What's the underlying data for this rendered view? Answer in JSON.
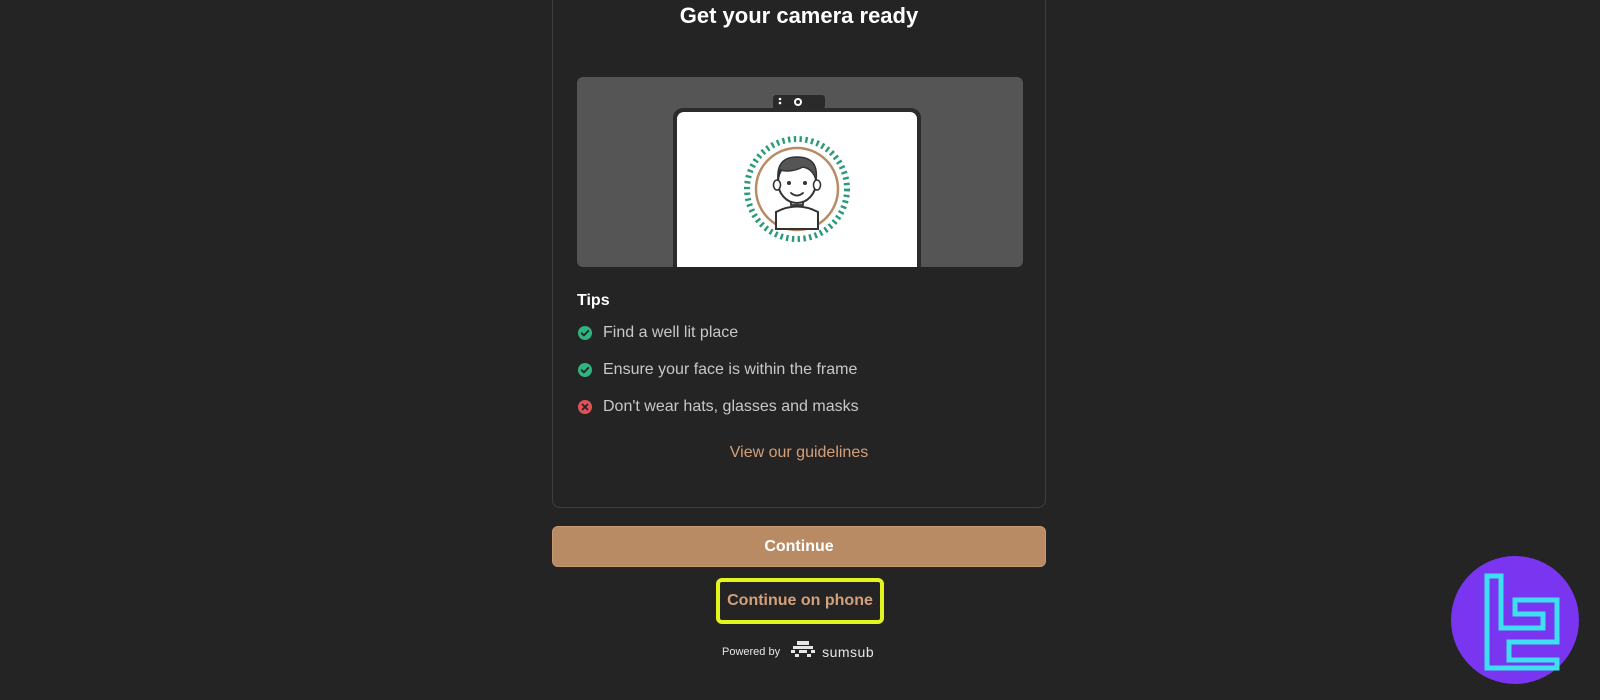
{
  "card": {
    "title": "Get your camera ready",
    "tips_heading": "Tips",
    "tips": [
      {
        "text": "Find a well lit place",
        "status": "ok",
        "icon": "check-circle-icon"
      },
      {
        "text": "Ensure your face is within the frame",
        "status": "ok",
        "icon": "check-circle-icon"
      },
      {
        "text": "Don't wear hats, glasses and masks",
        "status": "bad",
        "icon": "x-circle-icon"
      }
    ],
    "guidelines_link": "View our guidelines"
  },
  "actions": {
    "continue_label": "Continue",
    "continue_on_phone_label": "Continue on phone"
  },
  "footer": {
    "powered_by": "Powered by",
    "brand": "sumsub"
  },
  "colors": {
    "background": "#242424",
    "accent": "#b98b64",
    "link": "#d4a07a",
    "ok": "#2fb380",
    "bad": "#e0525a",
    "highlight": "#e3f51e",
    "corner_logo": "#7a35f0"
  }
}
